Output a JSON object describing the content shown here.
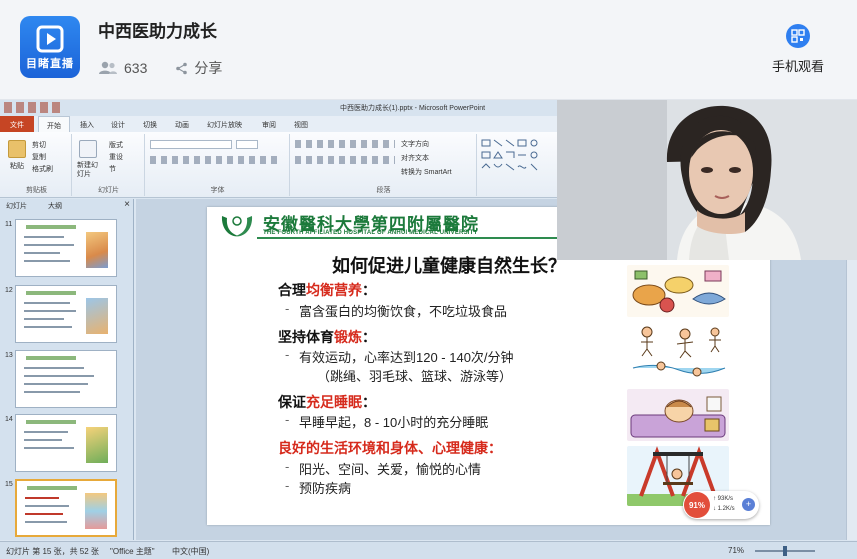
{
  "header": {
    "logo_text": "目睹直播",
    "channel_title": "中西医助力成长",
    "viewer_count": "633",
    "share_label": "分享",
    "mobile_label": "手机观看"
  },
  "ppt_window": {
    "title": "中西医助力成长(1).pptx - Microsoft PowerPoint",
    "tabs": [
      "文件",
      "开始",
      "插入",
      "设计",
      "切换",
      "动画",
      "幻灯片放映",
      "审阅",
      "视图"
    ],
    "active_tab": "开始",
    "ribbon": {
      "clipboard": {
        "label": "剪贴板",
        "paste": "粘贴",
        "cut": "剪切",
        "copy": "复制",
        "format_painter": "格式刷"
      },
      "slides": {
        "label": "幻灯片",
        "new_slide": "新建幻灯片",
        "layout": "版式",
        "reset": "重设",
        "section": "节"
      },
      "font": {
        "label": "字体"
      },
      "paragraph": {
        "label": "段落",
        "text_direction": "文字方向",
        "align_text": "对齐文本",
        "smartart": "转换为 SmartArt"
      }
    },
    "panel_tabs": [
      "幻灯片",
      "大纲"
    ],
    "thumbnail_numbers": [
      "11",
      "12",
      "13",
      "14",
      "15"
    ],
    "status": {
      "slide_position": "幻灯片 第 15 张，共 52 张",
      "theme": "\"Office 主题\"",
      "language": "中文(中国)",
      "zoom": "71%"
    }
  },
  "slide": {
    "hospital_cn": "安徽醫科大學第四附屬醫院",
    "hospital_en": "THE FOURTH AFFILIATED HOSPITAL OF ANHUI MEDICAL UNIVERSITY",
    "title": "如何促进儿童健康自然生长？",
    "sections": [
      {
        "prefix": "合理",
        "highlight": "均衡营养",
        "suffix": "：",
        "bullets": [
          "富含蛋白的均衡饮食，不吃垃圾食品"
        ]
      },
      {
        "prefix": "坚持体育",
        "highlight": "锻炼",
        "suffix": "：",
        "bullets": [
          "有效运动，心率达到120 - 140次/分钟"
        ],
        "sub": "（跳绳、羽毛球、篮球、游泳等）"
      },
      {
        "prefix": "保证",
        "highlight": "充足睡眠",
        "suffix": "：",
        "bullets": [
          "早睡早起，8 - 10小时的充分睡眠"
        ]
      },
      {
        "prefix": "",
        "highlight": "良好的生活环境和身体、心理健康",
        "suffix": "：",
        "bullets": [
          "阳光、空间、关爱，愉悦的心情",
          "预防疾病"
        ]
      }
    ]
  },
  "network_widget": {
    "percent": "91%",
    "upload": "93K/s",
    "download": "1.2K/s"
  },
  "colors": {
    "accent_blue": "#2f7ff0",
    "hospital_green": "#1c7a3b",
    "highlight_red": "#d62a1c"
  }
}
